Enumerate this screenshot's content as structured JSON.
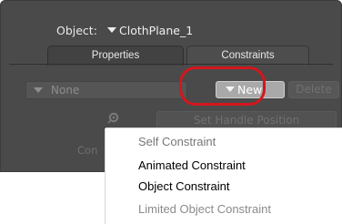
{
  "object_row": {
    "label": "Object:",
    "selected": "ClothPlane_1"
  },
  "tabs": [
    {
      "label": "Properties"
    },
    {
      "label": "Constraints"
    }
  ],
  "constraint_dropdown": {
    "value": "None"
  },
  "buttons": {
    "new_label": "New",
    "delete_label": "Delete",
    "set_handle_label": "Set Handle Position"
  },
  "partial_label": "Con",
  "menu": {
    "items": [
      {
        "label": "Self Constraint",
        "enabled": false
      },
      {
        "label": "Animated Constraint",
        "enabled": true
      },
      {
        "label": "Object Constraint",
        "enabled": true
      },
      {
        "label": "Limited Object Constraint",
        "enabled": false
      }
    ]
  },
  "colors": {
    "panel": "#4a4a4a",
    "highlight": "#d4161d",
    "menu_bg": "#ffffff"
  },
  "icons": {
    "dropdown": "triangle-down-icon",
    "settings": "gear-icon"
  }
}
